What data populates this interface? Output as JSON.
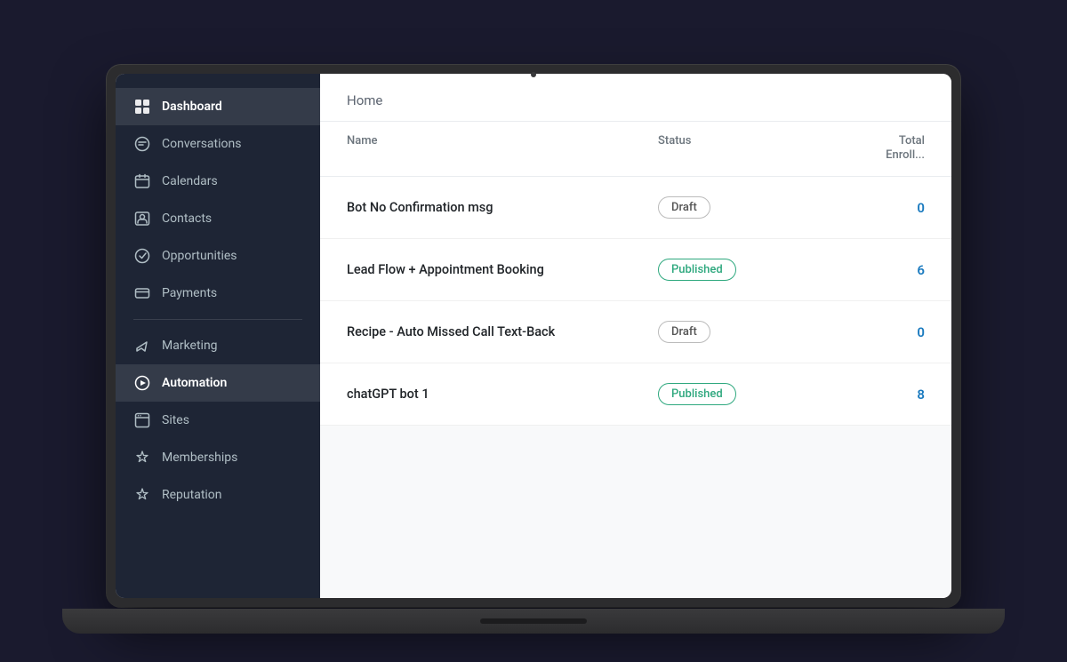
{
  "laptop": {
    "screen_title": "Home"
  },
  "sidebar": {
    "items": [
      {
        "id": "dashboard",
        "label": "Dashboard",
        "icon": "grid-icon",
        "active": true
      },
      {
        "id": "conversations",
        "label": "Conversations",
        "icon": "chat-icon",
        "active": false
      },
      {
        "id": "calendars",
        "label": "Calendars",
        "icon": "calendar-icon",
        "active": false
      },
      {
        "id": "contacts",
        "label": "Contacts",
        "icon": "contacts-icon",
        "active": false
      },
      {
        "id": "opportunities",
        "label": "Opportunities",
        "icon": "opportunities-icon",
        "active": false
      },
      {
        "id": "payments",
        "label": "Payments",
        "icon": "payments-icon",
        "active": false
      },
      {
        "id": "marketing",
        "label": "Marketing",
        "icon": "marketing-icon",
        "active": false
      },
      {
        "id": "automation",
        "label": "Automation",
        "icon": "automation-icon",
        "active": true
      },
      {
        "id": "sites",
        "label": "Sites",
        "icon": "sites-icon",
        "active": false
      },
      {
        "id": "memberships",
        "label": "Memberships",
        "icon": "memberships-icon",
        "active": false
      },
      {
        "id": "reputation",
        "label": "Reputation",
        "icon": "reputation-icon",
        "active": false
      }
    ]
  },
  "table": {
    "page_title": "Home",
    "columns": {
      "name": "Name",
      "status": "Status",
      "total_enrolled": "Total\nEnrolle..."
    },
    "rows": [
      {
        "id": "row1",
        "name": "Bot No Confirmation msg",
        "status": "Draft",
        "status_type": "draft",
        "count": "0"
      },
      {
        "id": "row2",
        "name": "Lead Flow + Appointment Booking",
        "status": "Published",
        "status_type": "published",
        "count": "6"
      },
      {
        "id": "row3",
        "name": "Recipe - Auto Missed Call Text-Back",
        "status": "Draft",
        "status_type": "draft",
        "count": "0"
      },
      {
        "id": "row4",
        "name": "chatGPT bot 1",
        "status": "Published",
        "status_type": "published",
        "count": "8"
      }
    ]
  }
}
